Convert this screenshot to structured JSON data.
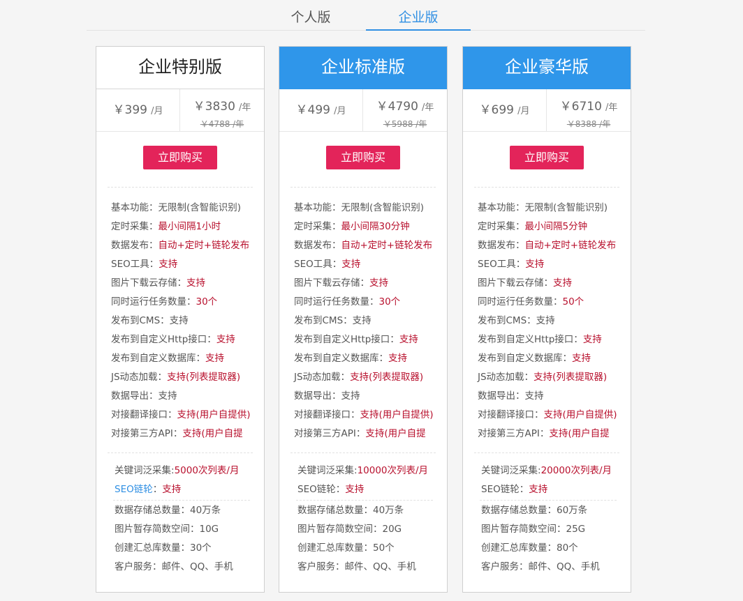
{
  "tabs": {
    "personal": "个人版",
    "enterprise": "企业版"
  },
  "plans": [
    {
      "title": "企业特别版",
      "month_price": "￥399",
      "month_unit": "/月",
      "year_price": "￥3830",
      "year_unit": "/年",
      "year_old": "￥4788 /年",
      "buy_label": "立即购买",
      "features": [
        {
          "label": "基本功能：",
          "value": "无限制(含智能识别)"
        },
        {
          "label": "定时采集：",
          "value": "最小间隔1小时"
        },
        {
          "label": "数据发布：",
          "value": "自动+定时+链轮发布"
        },
        {
          "label": "SEO工具：",
          "value": "支持"
        },
        {
          "label": "图片下载云存储：",
          "value": "支持"
        },
        {
          "label": "同时运行任务数量：",
          "value": "30个"
        },
        {
          "label": "发布到CMS：",
          "value": "支持"
        },
        {
          "label": "发布到自定义Http接口：",
          "value": "支持"
        },
        {
          "label": "发布到自定义数据库：",
          "value": "支持"
        },
        {
          "label": "JS动态加载：",
          "value": "支持(列表提取器)"
        },
        {
          "label": "数据导出：",
          "value": "支持"
        },
        {
          "label": "对接翻译接口：",
          "value": "支持(用户自提供)"
        },
        {
          "label": "对接第三方API：",
          "value": "支持(用户自提"
        }
      ],
      "keyword": {
        "label": "关键词泛采集:",
        "value": "5000次列表/月"
      },
      "seo_chain": {
        "label": "SEO链轮",
        "sep": "：",
        "value": "支持"
      },
      "storage": [
        {
          "label": "数据存储总数量：",
          "value": "40万条"
        },
        {
          "label": "图片暂存简数空间：",
          "value": "10G"
        },
        {
          "label": "创建汇总库数量：",
          "value": "30个"
        },
        {
          "label": "客户服务：",
          "value": "邮件、QQ、手机"
        }
      ]
    },
    {
      "title": "企业标准版",
      "month_price": "￥499",
      "month_unit": "/月",
      "year_price": "￥4790",
      "year_unit": "/年",
      "year_old": "￥5988 /年",
      "buy_label": "立即购买",
      "features": [
        {
          "label": "基本功能：",
          "value": "无限制(含智能识别)"
        },
        {
          "label": "定时采集：",
          "value": "最小间隔30分钟"
        },
        {
          "label": "数据发布：",
          "value": "自动+定时+链轮发布"
        },
        {
          "label": "SEO工具：",
          "value": "支持"
        },
        {
          "label": "图片下载云存储：",
          "value": "支持"
        },
        {
          "label": "同时运行任务数量：",
          "value": "30个"
        },
        {
          "label": "发布到CMS：",
          "value": "支持"
        },
        {
          "label": "发布到自定义Http接口：",
          "value": "支持"
        },
        {
          "label": "发布到自定义数据库：",
          "value": "支持"
        },
        {
          "label": "JS动态加载：",
          "value": "支持(列表提取器)"
        },
        {
          "label": "数据导出：",
          "value": "支持"
        },
        {
          "label": "对接翻译接口：",
          "value": "支持(用户自提供)"
        },
        {
          "label": "对接第三方API：",
          "value": "支持(用户自提"
        }
      ],
      "keyword": {
        "label": "关键词泛采集:",
        "value": "10000次列表/月"
      },
      "seo_chain": {
        "label": "SEO链轮",
        "sep": "：",
        "value": "支持"
      },
      "storage": [
        {
          "label": "数据存储总数量：",
          "value": "40万条"
        },
        {
          "label": "图片暂存简数空间：",
          "value": "20G"
        },
        {
          "label": "创建汇总库数量：",
          "value": "50个"
        },
        {
          "label": "客户服务：",
          "value": "邮件、QQ、手机"
        }
      ]
    },
    {
      "title": "企业豪华版",
      "month_price": "￥699",
      "month_unit": "/月",
      "year_price": "￥6710",
      "year_unit": "/年",
      "year_old": "￥8388 /年",
      "buy_label": "立即购买",
      "features": [
        {
          "label": "基本功能：",
          "value": "无限制(含智能识别)"
        },
        {
          "label": "定时采集：",
          "value": "最小间隔5分钟"
        },
        {
          "label": "数据发布：",
          "value": "自动+定时+链轮发布"
        },
        {
          "label": "SEO工具：",
          "value": "支持"
        },
        {
          "label": "图片下载云存储：",
          "value": "支持"
        },
        {
          "label": "同时运行任务数量：",
          "value": "50个"
        },
        {
          "label": "发布到CMS：",
          "value": "支持"
        },
        {
          "label": "发布到自定义Http接口：",
          "value": "支持"
        },
        {
          "label": "发布到自定义数据库：",
          "value": "支持"
        },
        {
          "label": "JS动态加载：",
          "value": "支持(列表提取器)"
        },
        {
          "label": "数据导出：",
          "value": "支持"
        },
        {
          "label": "对接翻译接口：",
          "value": "支持(用户自提供)"
        },
        {
          "label": "对接第三方API：",
          "value": "支持(用户自提"
        }
      ],
      "keyword": {
        "label": "关键词泛采集:",
        "value": "20000次列表/月"
      },
      "seo_chain": {
        "label": "SEO链轮",
        "sep": "：",
        "value": "支持"
      },
      "storage": [
        {
          "label": "数据存储总数量：",
          "value": "60万条"
        },
        {
          "label": "图片暂存简数空间：",
          "value": "25G"
        },
        {
          "label": "创建汇总库数量：",
          "value": "80个"
        },
        {
          "label": "客户服务：",
          "value": "邮件、QQ、手机"
        }
      ]
    }
  ],
  "colors": {
    "accent": "#2f96ea",
    "buy": "#e3245a",
    "highlight": "#b8102d"
  }
}
